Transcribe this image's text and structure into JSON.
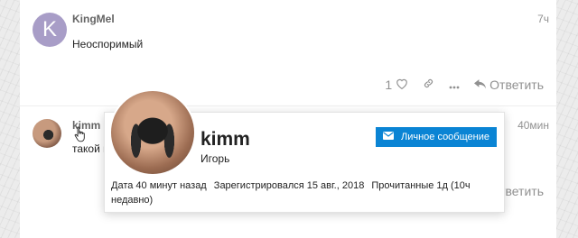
{
  "post1": {
    "avatar_letter": "K",
    "username": "KingMel",
    "time": "7ч",
    "text": "Неоспоримый",
    "like_count": "1",
    "reply_label": "Ответить"
  },
  "post2": {
    "username": "kimm",
    "time": "40мин",
    "text": "такой к",
    "reply_label": "тветить"
  },
  "card": {
    "username": "kimm",
    "full_name": "Игорь",
    "message_button": "Личное сообщение",
    "date_label": "Дата 40 минут назад",
    "registered_label": "Зарегистрировался 15 авг., 2018",
    "read_label": "Прочитанные 1д (10ч недавно)"
  },
  "colors": {
    "accent": "#0a84d4",
    "avatar_bg": "#a89dc7",
    "muted": "#919191"
  },
  "icons": [
    "heart-icon",
    "link-icon",
    "more-icon",
    "reply-icon",
    "envelope-icon",
    "pointer-cursor-icon"
  ]
}
